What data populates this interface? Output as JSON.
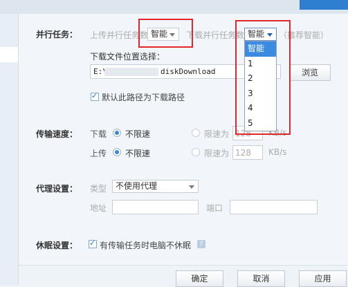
{
  "parallel": {
    "section_label": "并行任务：",
    "upload_label": "上传并行任务数",
    "upload_value": "智能",
    "download_label": "下载并行任务数",
    "download_value": "智能",
    "recommend_hint": "（推荐智能）",
    "dropdown_options": [
      "智能",
      "1",
      "2",
      "3",
      "4",
      "5"
    ],
    "dropdown_selected_index": 0
  },
  "download_location": {
    "label": "下载文件位置选择：",
    "path_prefix": "E:\\",
    "path_suffix": "diskDownload",
    "browse_label": "浏览",
    "default_checkbox_label": "默认此路径为下载路径"
  },
  "speed": {
    "section_label": "传输速度：",
    "download_label": "下载",
    "upload_label": "上传",
    "unlimited_label": "不限速",
    "limit_label": "限速为",
    "download_limit_value": "128",
    "upload_limit_value": "128",
    "unit": "KB/s"
  },
  "proxy": {
    "section_label": "代理设置：",
    "type_label": "类型",
    "type_value": "不使用代理",
    "address_label": "地址",
    "port_label": "端口"
  },
  "sleep": {
    "section_label": "休眠设置：",
    "checkbox_label": "有传输任务时电脑不休眠",
    "help_icon": "?"
  },
  "footer": {
    "ok_label": "确定",
    "cancel_label": "取消",
    "apply_label": "应用"
  },
  "colors": {
    "highlight_box": "#e0262b",
    "selected_item": "#3b8be0",
    "radio_active": "#3a86d8"
  }
}
